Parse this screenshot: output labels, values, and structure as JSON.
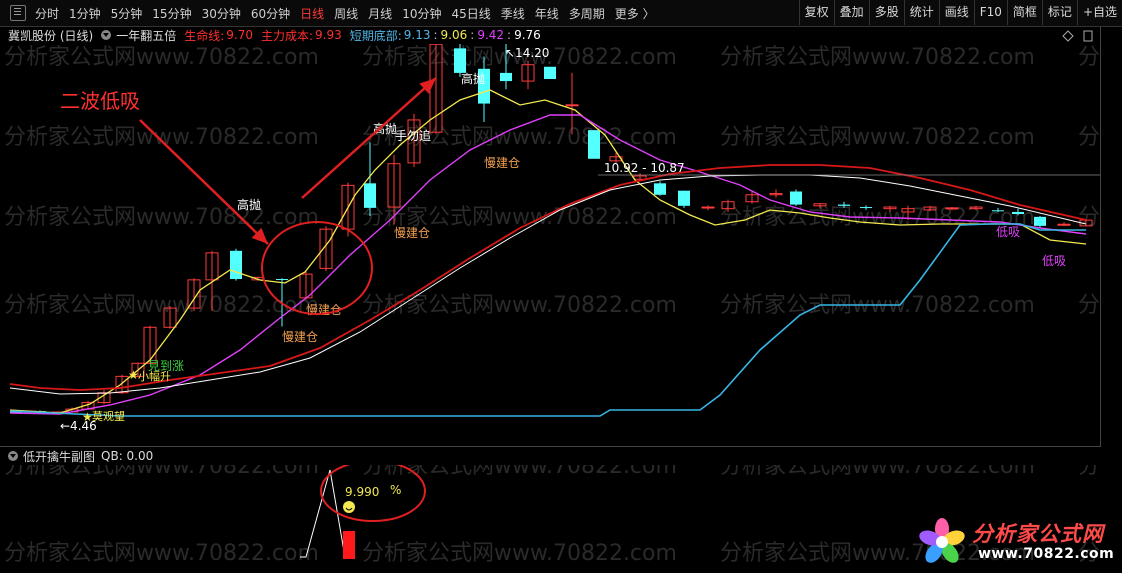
{
  "toolbar": {
    "periods": [
      {
        "label": "分时",
        "active": false
      },
      {
        "label": "1分钟",
        "active": false
      },
      {
        "label": "5分钟",
        "active": false
      },
      {
        "label": "15分钟",
        "active": false
      },
      {
        "label": "30分钟",
        "active": false
      },
      {
        "label": "60分钟",
        "active": false
      },
      {
        "label": "日线",
        "active": true
      },
      {
        "label": "周线",
        "active": false
      },
      {
        "label": "月线",
        "active": false
      },
      {
        "label": "10分钟",
        "active": false
      },
      {
        "label": "45日线",
        "active": false
      },
      {
        "label": "季线",
        "active": false
      },
      {
        "label": "年线",
        "active": false
      },
      {
        "label": "多周期",
        "active": false
      },
      {
        "label": "更多 〉",
        "active": false
      }
    ],
    "buttons": [
      "复权",
      "叠加",
      "多股",
      "统计",
      "画线",
      "F10",
      "简框",
      "标记",
      "+自选"
    ]
  },
  "info": {
    "title": "冀凯股份 (日线)",
    "indicator": "一年翻五倍",
    "life_label": "生命线:",
    "life_value": "9.70",
    "main_cost_label": "主力成本:",
    "main_cost_value": "9.93",
    "short_bottom_label": "短期底部:",
    "v1": "9.13",
    "v2": "9.06",
    "v3": "9.42",
    "v4": "9.76",
    "sep": ":"
  },
  "annotations": {
    "wave_label": "二波低吸",
    "high_price": "14.20",
    "low_price": "4.46",
    "range_label": "10.92 - 10.87"
  },
  "signals": {
    "high_sell": "高抛",
    "slow_build": "慢建仓",
    "no_chase": "手勿追",
    "see_rise": "見到涨",
    "small_rise": "小幅升",
    "wait_watch": "莫观望",
    "low_absorb": "低吸",
    "low_buy": "低吸"
  },
  "watermark": "分析家公式网www.70822.com",
  "sub": {
    "title": "低开擒牛副图",
    "qb_label": "QB: 0.00",
    "value": "9.990",
    "unit": "%"
  },
  "logo": {
    "title": "分析家公式网",
    "url": "www.70822.com"
  },
  "colors": {
    "up": "#ff3b3b",
    "down": "#54ffff",
    "yellow_line": "#f2e94e",
    "magenta_line": "#e040fb",
    "red_line": "#d81818",
    "white_line": "#ffffff",
    "blue_line": "#38b6e6"
  }
}
